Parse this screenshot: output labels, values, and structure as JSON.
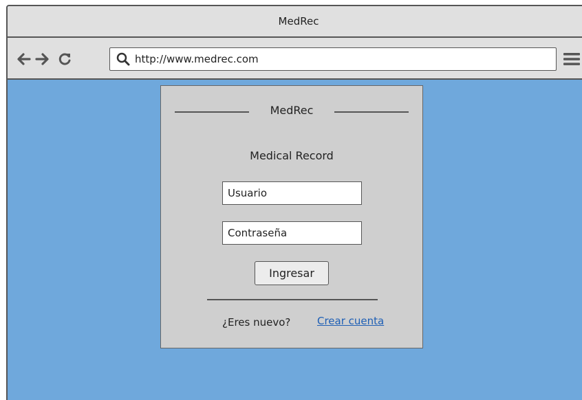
{
  "window": {
    "title": "MedRec"
  },
  "browser": {
    "url": "http://www.medrec.com",
    "icons": [
      "back-arrow-icon",
      "forward-arrow-icon",
      "refresh-icon",
      "search-icon",
      "hamburger-menu-icon"
    ]
  },
  "login": {
    "header": "MedRec",
    "subtitle": "Medical Record",
    "username_value": "Usuario",
    "password_value": "Contraseña",
    "submit_label": "Ingresar",
    "signup_question": "¿Eres nuevo?",
    "signup_link": "Crear cuenta"
  },
  "colors": {
    "page_background": "#6fa8dc",
    "chrome": "#e0e0e0",
    "panel": "#cfcfcf",
    "link": "#1e5fb5"
  }
}
